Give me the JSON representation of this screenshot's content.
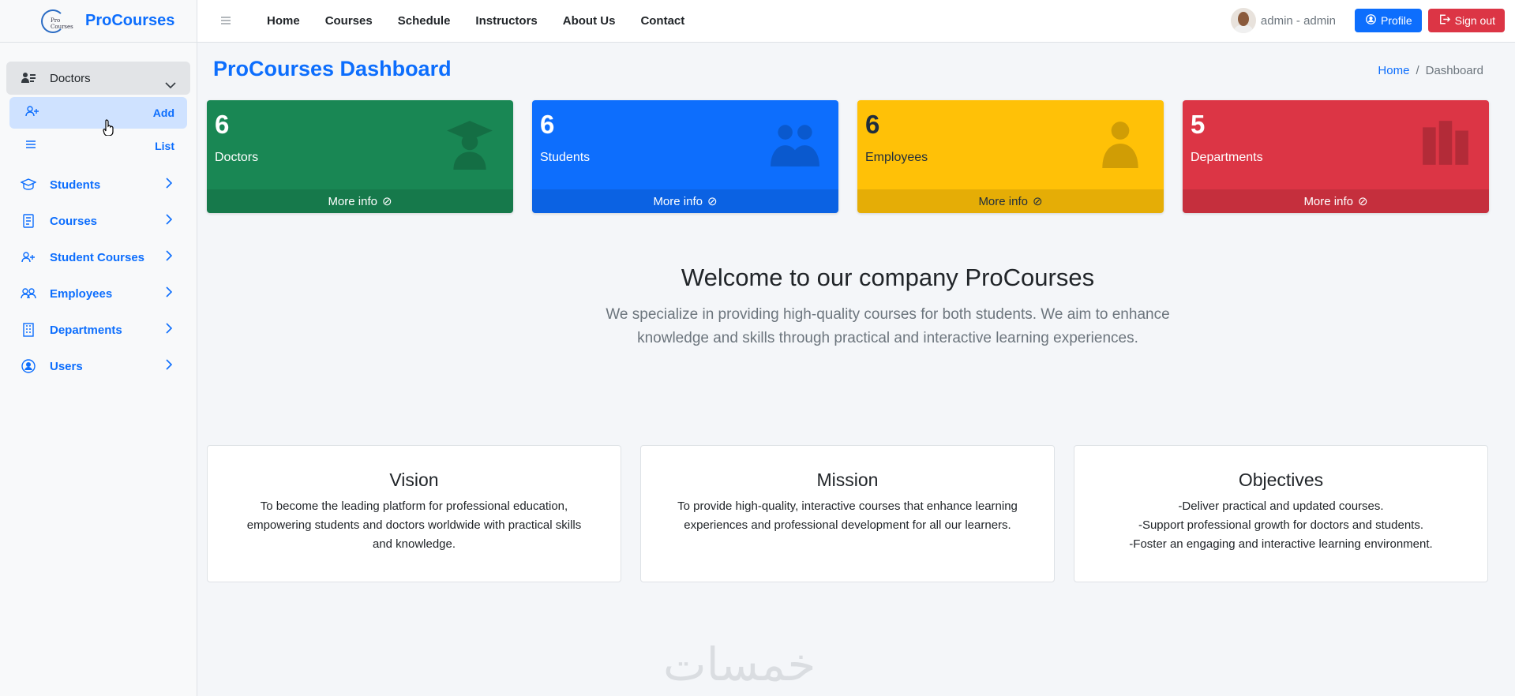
{
  "brand": {
    "name": "ProCourses",
    "logo_text": "Pro Courses"
  },
  "topnav": {
    "links": [
      "Home",
      "Courses",
      "Schedule",
      "Instructors",
      "About Us",
      "Contact"
    ],
    "user_name": "admin - admin",
    "profile_label": "Profile",
    "signout_label": "Sign out"
  },
  "sidebar": {
    "open_group": {
      "label": "Doctors",
      "children": [
        {
          "label": "Add"
        },
        {
          "label": "List"
        }
      ]
    },
    "items": [
      {
        "label": "Students"
      },
      {
        "label": "Courses"
      },
      {
        "label": "Student Courses"
      },
      {
        "label": "Employees"
      },
      {
        "label": "Departments"
      },
      {
        "label": "Users"
      }
    ]
  },
  "page": {
    "title": "ProCourses Dashboard",
    "breadcrumb": {
      "home": "Home",
      "sep": "/",
      "current": "Dashboard"
    }
  },
  "stats": [
    {
      "value": "6",
      "label": "Doctors",
      "more": "More info",
      "color": "#198754",
      "icon": "graduate-icon"
    },
    {
      "value": "6",
      "label": "Students",
      "more": "More info",
      "color": "#0d6efd",
      "icon": "users-icon"
    },
    {
      "value": "6",
      "label": "Employees",
      "more": "More info",
      "color": "#ffc107",
      "icon": "user-icon"
    },
    {
      "value": "5",
      "label": "Departments",
      "more": "More info",
      "color": "#dc3545",
      "icon": "books-icon"
    }
  ],
  "welcome": {
    "title": "Welcome to our company ProCourses",
    "line1": "We specialize in providing high-quality courses for both students. We aim to enhance",
    "line2": "knowledge and skills through practical and interactive learning experiences."
  },
  "cards": [
    {
      "title": "Vision",
      "lines": [
        "To become the leading platform for professional education,",
        "empowering students and doctors worldwide with practical skills",
        "and knowledge."
      ]
    },
    {
      "title": "Mission",
      "lines": [
        "To provide high-quality, interactive courses that enhance learning",
        "experiences and professional development for all our learners."
      ]
    },
    {
      "title": "Objectives",
      "lines": [
        "-Deliver practical and updated courses.",
        "-Support professional growth for doctors and students.",
        "-Foster an engaging and interactive learning environment."
      ]
    }
  ],
  "watermark": "خمسات"
}
